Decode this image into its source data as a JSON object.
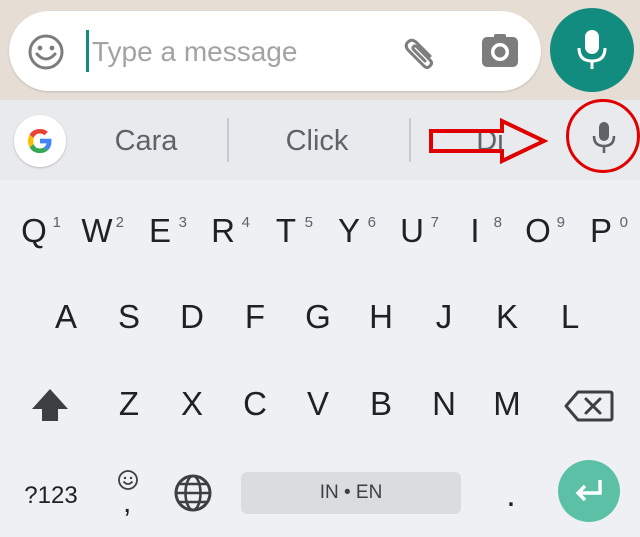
{
  "composer": {
    "placeholder": "Type a message",
    "emoji_icon": "smiley-icon",
    "attach_icon": "paperclip-icon",
    "camera_icon": "camera-icon",
    "send_icon": "microphone-icon",
    "accent": "#128c7e"
  },
  "suggestions": {
    "logo_icon": "google-g-icon",
    "items": [
      "Cara",
      "Click",
      "Di"
    ],
    "voice_icon": "microphone-icon"
  },
  "annotation": {
    "arrow_color": "#e00000",
    "circle_color": "#e00000"
  },
  "keyboard": {
    "row1": [
      {
        "key": "Q",
        "hint": "1"
      },
      {
        "key": "W",
        "hint": "2"
      },
      {
        "key": "E",
        "hint": "3"
      },
      {
        "key": "R",
        "hint": "4"
      },
      {
        "key": "T",
        "hint": "5"
      },
      {
        "key": "Y",
        "hint": "6"
      },
      {
        "key": "U",
        "hint": "7"
      },
      {
        "key": "I",
        "hint": "8"
      },
      {
        "key": "O",
        "hint": "9"
      },
      {
        "key": "P",
        "hint": "0"
      }
    ],
    "row2": [
      "A",
      "S",
      "D",
      "F",
      "G",
      "H",
      "J",
      "K",
      "L"
    ],
    "row3": [
      "Z",
      "X",
      "C",
      "V",
      "B",
      "N",
      "M"
    ],
    "shift_icon": "shift-arrow-icon",
    "backspace_icon": "backspace-icon",
    "symbols_label": "?123",
    "comma_label": ",",
    "emoji_icon": "smiley-icon",
    "globe_icon": "globe-icon",
    "space_label": "IN • EN",
    "period_label": ".",
    "enter_icon": "enter-arrow-icon",
    "enter_color": "#5cc0a6"
  }
}
